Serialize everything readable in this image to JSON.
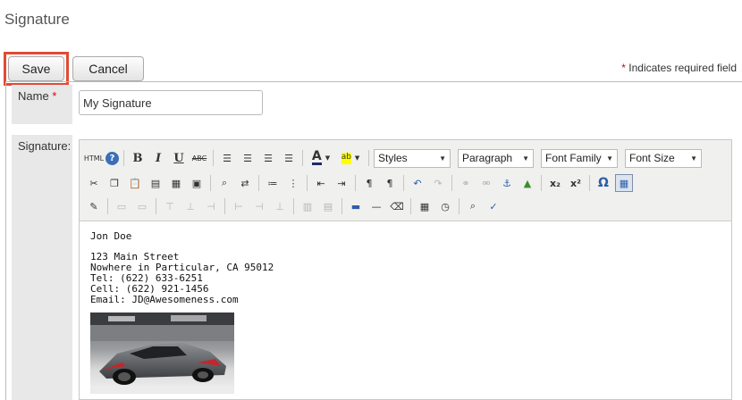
{
  "page": {
    "title": "Signature"
  },
  "actions": {
    "save_label": "Save",
    "cancel_label": "Cancel"
  },
  "required_note": {
    "star": "*",
    "text": " Indicates required field"
  },
  "form": {
    "name_label": "Name",
    "required_star": "*",
    "name_value": "My Signature",
    "signature_label": "Signature:"
  },
  "editor": {
    "toolbar": {
      "html_label": "HTML",
      "help_glyph": "?",
      "styles": "Styles",
      "paragraph": "Paragraph",
      "font_family": "Font Family",
      "font_size": "Font Size"
    },
    "content": {
      "lines": [
        "Jon Doe",
        "",
        "123 Main Street",
        "Nowhere in Particular, CA 95012",
        "Tel: (622) 633-6251",
        "Cell: (622) 921-1456",
        "Email: JD@Awesomeness.com"
      ]
    }
  },
  "icons": [
    "help-icon",
    "bold-icon",
    "italic-icon",
    "underline-icon",
    "strikethrough-icon",
    "align-left-icon",
    "align-center-icon",
    "align-right-icon",
    "align-justify-icon",
    "font-color-icon",
    "highlight-icon",
    "cut-icon",
    "copy-icon",
    "paste-icon",
    "paste-text-icon",
    "paste-word-icon",
    "select-all-icon",
    "find-icon",
    "replace-icon",
    "bullet-list-icon",
    "numbered-list-icon",
    "outdent-icon",
    "indent-icon",
    "ltr-icon",
    "rtl-icon",
    "undo-icon",
    "redo-icon",
    "link-icon",
    "unlink-icon",
    "anchor-icon",
    "image-icon",
    "subscript-icon",
    "superscript-icon",
    "special-char-icon",
    "table-icon",
    "edit-icon",
    "hr-icon",
    "eraser-icon",
    "date-icon",
    "time-icon",
    "preview-icon",
    "spellcheck-icon"
  ],
  "colors": {
    "highlight_border": "#e24a33",
    "required": "#dd0000",
    "label_bg": "#e8e8e8",
    "toolbar_bg": "#f0f0ee"
  }
}
